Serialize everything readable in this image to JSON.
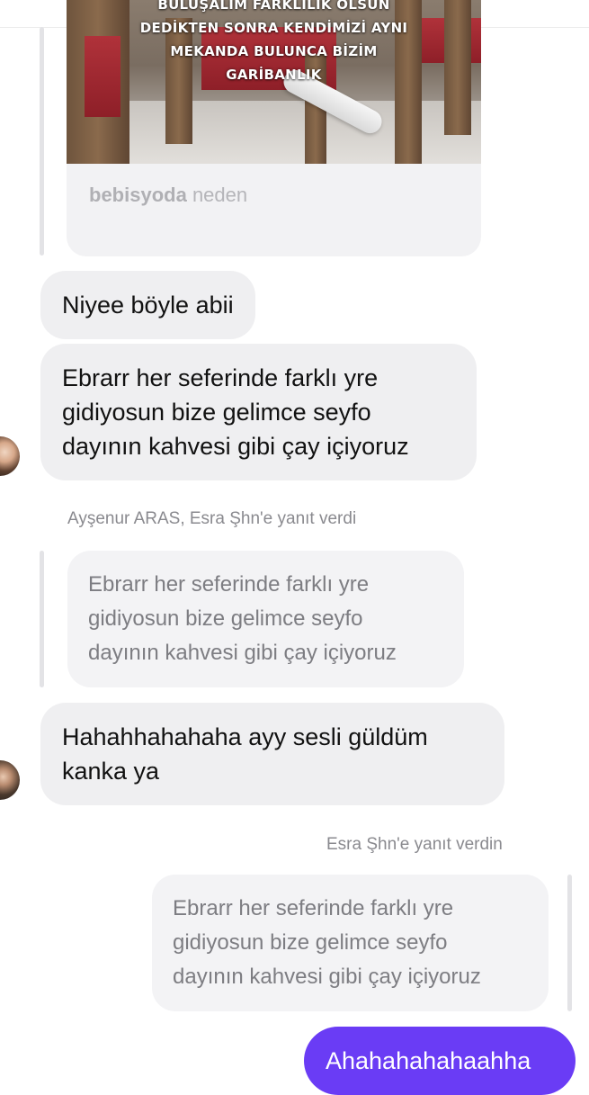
{
  "post": {
    "caption_lines": [
      "BULUŞALIM FARKLILIK OLSUN",
      "DEDİKTEN SONRA KENDİMİZİ AYNI",
      "MEKANDA BULUNCA BİZİM",
      "GARİBANLIK"
    ],
    "username": "bebisyoda",
    "post_text": "neden"
  },
  "messages": {
    "msg1": "Niyee böyle abii",
    "msg2_lines": [
      "Ebrarr her seferinde farklı yre",
      "gidiyosun bize gelimce seyfo",
      "dayının kahvesi gibi çay içiyoruz"
    ],
    "reply1_label": "Ayşenur ARAS, Esra Şhn'e yanıt verdi",
    "reply1_quote_lines": [
      "Ebrarr her seferinde farklı yre",
      "gidiyosun bize gelimce seyfo",
      "dayının kahvesi gibi çay içiyoruz"
    ],
    "msg3_lines": [
      "Hahahhahahaha ayy sesli güldüm",
      "kanka ya"
    ],
    "reply2_label": "Esra Şhn'e yanıt verdin",
    "reply2_quote_lines": [
      "Ebrarr her seferinde farklı yre",
      "gidiyosun bize gelimce seyfo",
      "dayının kahvesi gibi çay içiyoruz"
    ],
    "sent_text": "Ahahahahahaahha"
  },
  "colors": {
    "sent_bubble": "#6a3cf5",
    "received_bubble": "#efeff1",
    "quote_bubble": "#f3f3f5"
  }
}
